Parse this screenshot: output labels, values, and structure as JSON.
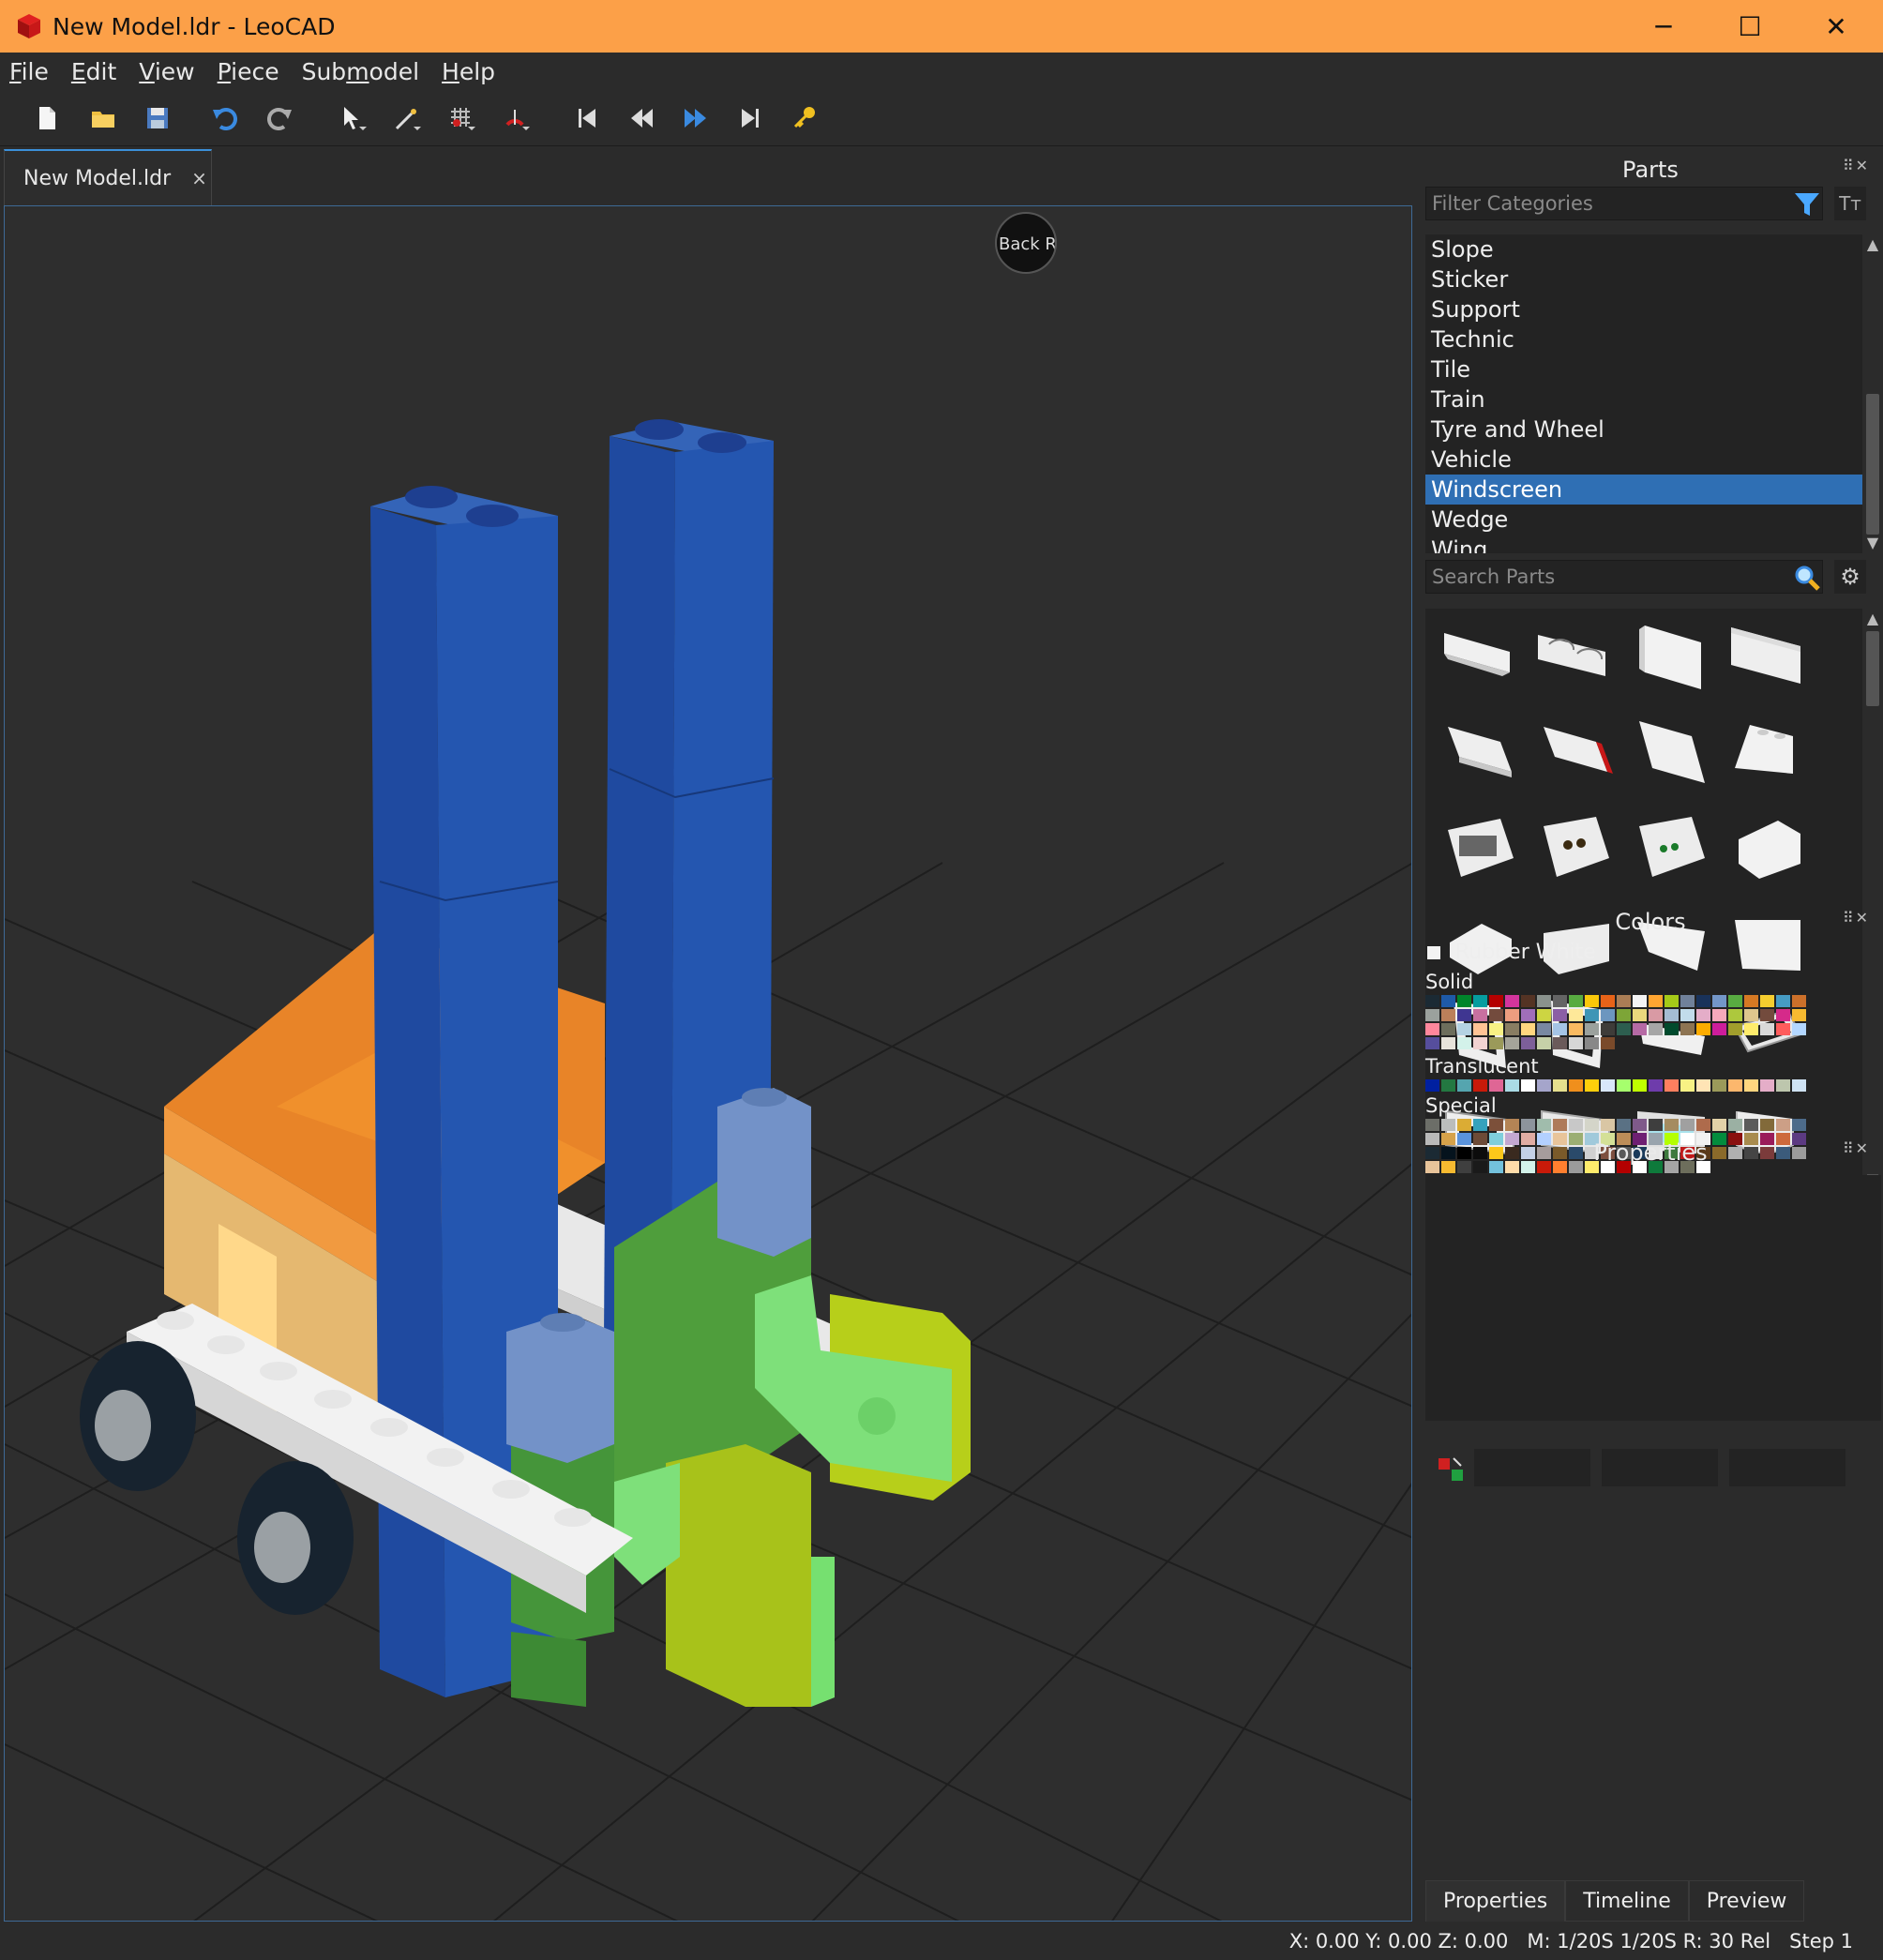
{
  "window": {
    "title": "New Model.ldr - LeoCAD",
    "minimize": "─",
    "maximize": "☐",
    "close": "✕"
  },
  "menu": [
    {
      "label": "File",
      "key": "F",
      "rest": "ile"
    },
    {
      "label": "Edit",
      "key": "E",
      "rest": "dit"
    },
    {
      "label": "View",
      "key": "V",
      "rest": "iew"
    },
    {
      "label": "Piece",
      "key": "P",
      "rest": "iece"
    },
    {
      "label": "Submodel",
      "key": "Sub",
      "rest": "m",
      "tail": "odel"
    },
    {
      "label": "Help",
      "key": "H",
      "rest": "elp"
    }
  ],
  "tabs": {
    "document": "New Model.ldr",
    "close": "×"
  },
  "viewsphere": {
    "label": "Back Right"
  },
  "parts_panel": {
    "title": "Parts",
    "filter_placeholder": "Filter Categories",
    "categories": [
      "Slope",
      "Sticker",
      "Support",
      "Technic",
      "Tile",
      "Train",
      "Tyre and Wheel",
      "Vehicle",
      "Windscreen",
      "Wedge",
      "Wing"
    ],
    "selected_category": "Windscreen",
    "search_placeholder": "Search Parts"
  },
  "colors_panel": {
    "title": "Colors",
    "current": "Rubber White",
    "groups": {
      "solid": "Solid",
      "translucent": "Translucent",
      "special": "Special"
    },
    "solid": [
      "#1b2a34",
      "#1e5aa8",
      "#00852b",
      "#069d9f",
      "#b40000",
      "#d3359d",
      "#543324",
      "#8a928d",
      "#646464",
      "#58ab41",
      "#fac80a",
      "#e76318",
      "#aa7d55",
      "#f4f4f4",
      "#ffa531",
      "#a5ca18",
      "#70819a",
      "#19325a",
      "#7396c8",
      "#58ab41",
      "#d67923",
      "#f5cd2f",
      "#469bc3",
      "#cc702a",
      "#9ba19d",
      "#bb805a",
      "#3f3691",
      "#c870a0",
      "#734b3d",
      "#ed9d7f",
      "#a06eb9",
      "#cdd542",
      "#8b5fa5",
      "#fee899",
      "#3e95b6",
      "#6c96bf",
      "#7da537",
      "#ead87d",
      "#d99aa4",
      "#a4bdd3",
      "#c2dceb",
      "#e4adc8",
      "#f6a9bb",
      "#adc83d",
      "#dec68d",
      "#734b3d",
      "#d52a8a",
      "#f7ba30",
      "#ff879c",
      "#6d6e5c",
      "#b4d2e3",
      "#ffc395",
      "#f8f184",
      "#897d62",
      "#ffd67f",
      "#7988a1",
      "#a5c4e6",
      "#f9ba61",
      "#9ba19d",
      "#3e3c39",
      "#2d5e4f",
      "#b66aa5",
      "#a6a6a6",
      "#004a2d",
      "#8d7452",
      "#fcac00",
      "#ce1d9b",
      "#a19e2c",
      "#ffec6c",
      "#d9d9d9",
      "#ff5c5c",
      "#b3d7ff",
      "#564e9d",
      "#e6e3da",
      "#d3f2ea",
      "#f2d3d1",
      "#9b9a5a",
      "#a5a499",
      "#7d5f99",
      "#c6d0a8",
      "#6b5a5a",
      "#d6d6d6",
      "#888888",
      "#7a4a2a"
    ],
    "translucent": [
      "#0020a0",
      "#237841",
      "#55a5af",
      "#c91a09",
      "#df6695",
      "#aadbe5",
      "#ffffff",
      "#a5a5cb",
      "#e5df8e",
      "#f08f1c",
      "#ffcf0b",
      "#d8e7fa",
      "#a6ff6d",
      "#c0ff00",
      "#6e3cab",
      "#ff7f5f",
      "#f8f184",
      "#ffe4b5",
      "#9b9a5a",
      "#fcb76d",
      "#ffd67f",
      "#e4adc8",
      "#bdc6ad",
      "#cfe2f3"
    ],
    "special": [
      "#6c6e68",
      "#bbbdbc",
      "#dbac34",
      "#35a2bd",
      "#7c503a",
      "#b48455",
      "#8d949c",
      "#a0bcac",
      "#ae7a59",
      "#c8c8c8",
      "#d4d5c9",
      "#d9c6a4",
      "#5a7184",
      "#7f5a8a",
      "#3e3e3e",
      "#a58c60",
      "#a0a0a0",
      "#ae6b4c",
      "#e2d2a8",
      "#9bb0a3",
      "#5b5b5b",
      "#826a3a",
      "#cc9f86",
      "#4d6b8a",
      "#b9b9b9",
      "#d6a24a",
      "#5a93db",
      "#6d4b37",
      "#7fcedc",
      "#c3a8d1",
      "#e0aca3",
      "#b3d0ff",
      "#e8c49a",
      "#9bae73",
      "#a0c9db",
      "#d4e097",
      "#bd8d58",
      "#6e1f72",
      "#99a4ad",
      "#b4ff00",
      "#ffffff",
      "#f1f1f1",
      "#038c3d",
      "#8a0f0f",
      "#a88b4e",
      "#9a1c5a",
      "#cd6a3d",
      "#5c3a82",
      "#1b2a34",
      "#05131d",
      "#000000",
      "#0c0c0c",
      "#fcc71a",
      "#3a2a1f",
      "#c4d0e6",
      "#a69c9c",
      "#7a5a2a",
      "#2a4a6a",
      "#d0d0d0",
      "#7d4f3f",
      "#5a5a5a",
      "#1a3a5a",
      "#e6e6e6",
      "#3e7a3e",
      "#c01a1a",
      "#5a3a1a",
      "#8a6a2a",
      "#b0b0b0",
      "#454545",
      "#7b3b3b",
      "#3b5b7b",
      "#9c9c9c",
      "#e8c49a",
      "#f7ba30",
      "#3f3f3f",
      "#1a1a1a",
      "#73c1dc",
      "#ffdcaa",
      "#d3f2ea",
      "#c91a09",
      "#ff7f2f",
      "#9b9b9b",
      "#ffec6c",
      "#ffffff",
      "#b40000",
      "#ffffff",
      "#0e7a3b",
      "#a5a5a5",
      "#6d6e5c",
      "#ffffff"
    ]
  },
  "properties_panel": {
    "title": "Properties"
  },
  "bottom_tabs": [
    "Properties",
    "Timeline",
    "Preview"
  ],
  "status": {
    "coords": "X: 0.00 Y: 0.00 Z: 0.00",
    "snap": "M: 1/20S 1/20S R: 30 Rel",
    "step": "Step 1"
  }
}
